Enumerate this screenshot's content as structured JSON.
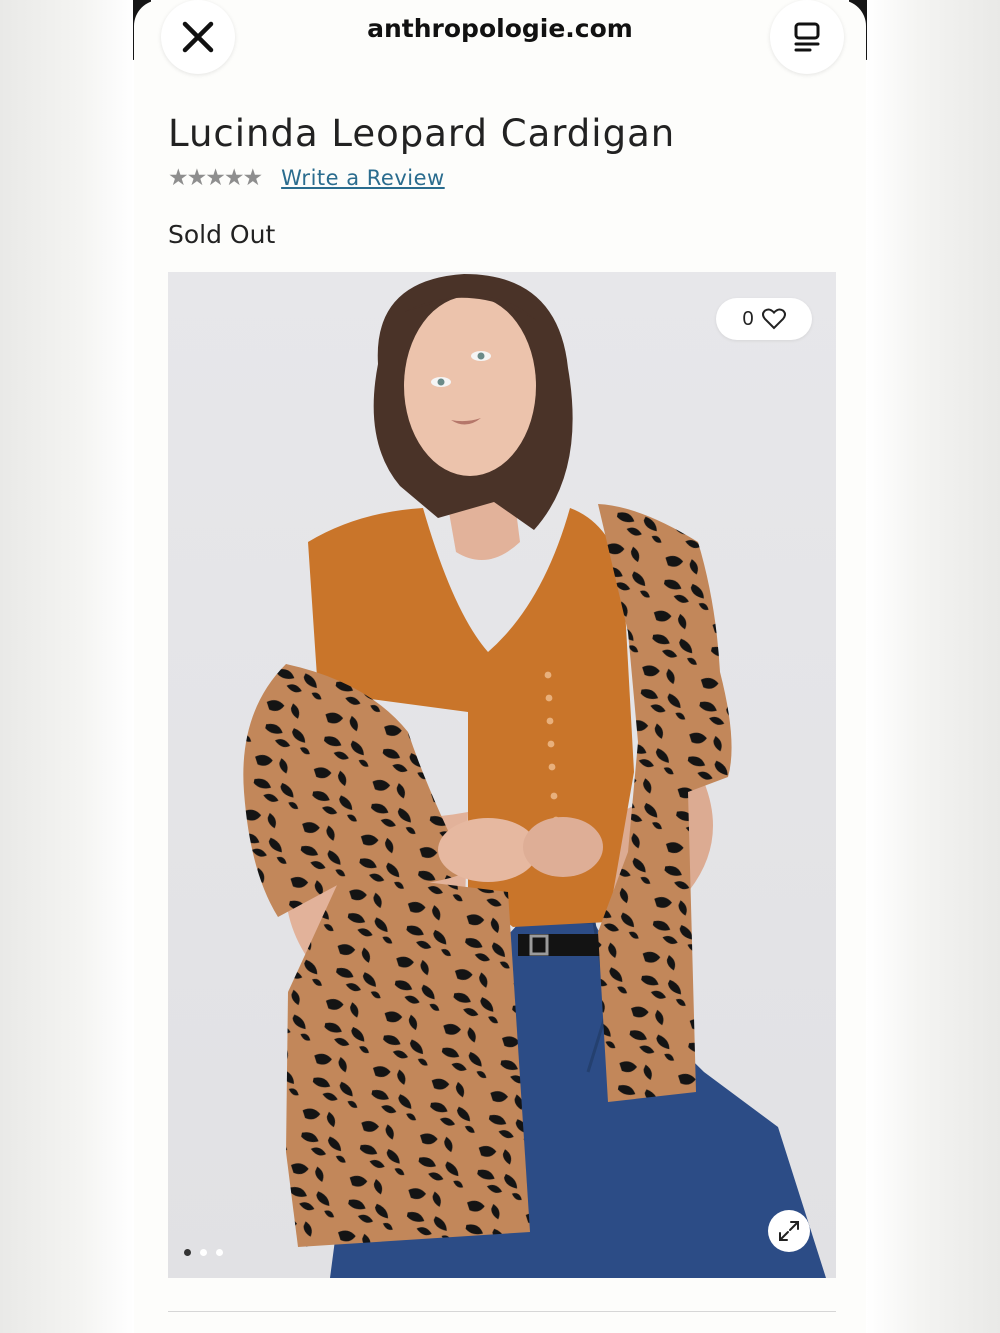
{
  "browser": {
    "site": "anthropologie.com",
    "close_icon": "close-icon",
    "reader_icon": "reader-mode-icon"
  },
  "product": {
    "title": "Lucinda Leopard Cardigan",
    "rating_stars": "★★★★★",
    "review_link": "Write a Review",
    "status": "Sold Out"
  },
  "gallery": {
    "like_count": "0",
    "heart_icon": "heart-icon",
    "expand_icon": "expand-icon",
    "current_image": 1,
    "total_images": 3
  },
  "colors": {
    "link": "#2a6c8e",
    "cardigan": "#c2875a",
    "top": "#c9752a",
    "jeans": "#2c4c86"
  }
}
